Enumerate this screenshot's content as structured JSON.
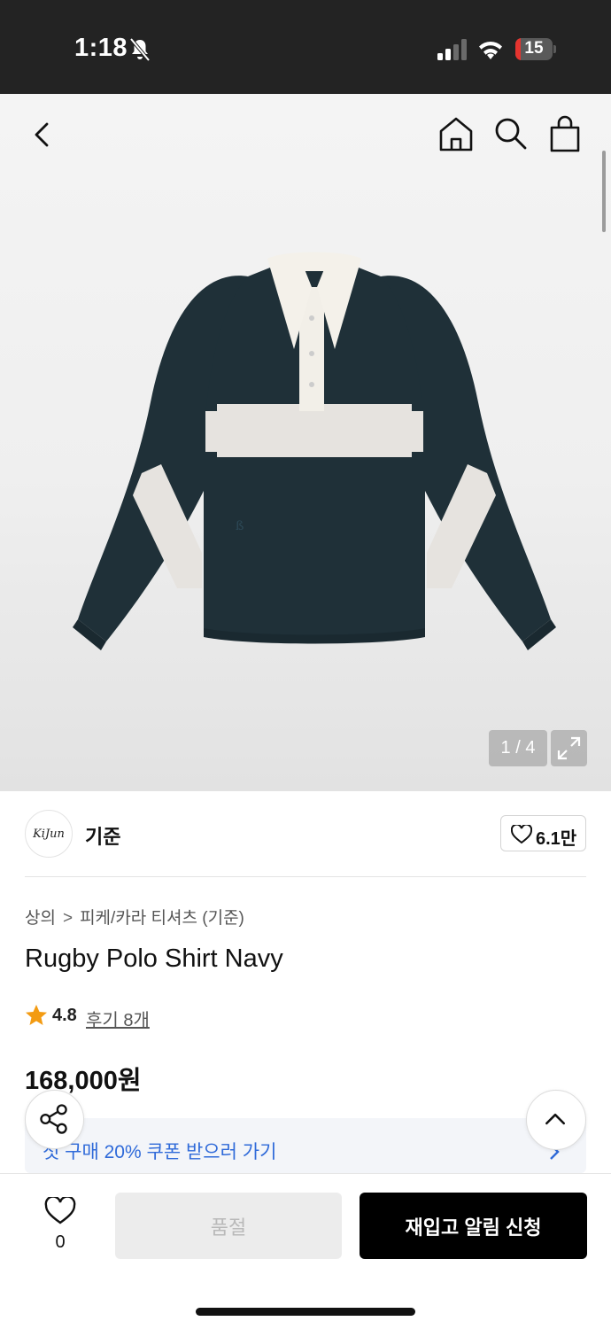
{
  "status_bar": {
    "time": "1:18",
    "battery": "15",
    "battery_level": 0.15,
    "battery_color": "#e5342f",
    "icons": [
      "bell-slash-icon",
      "cellular-signal-icon",
      "wifi-icon",
      "battery-icon"
    ]
  },
  "gallery": {
    "page_counter": "1 / 4",
    "current_page": 1,
    "total_pages": 4,
    "icons": [
      "back-icon",
      "home-icon",
      "search-icon",
      "shopping-bag-icon",
      "expand-icon"
    ]
  },
  "brand": {
    "logo_text": "KiJun",
    "name": "기준",
    "likes": "6.1만"
  },
  "product": {
    "breadcrumb": [
      "상의",
      "피케/카라 티셔츠 (기준)"
    ],
    "title": "Rugby Polo Shirt Navy",
    "rating": "4.8",
    "review_link": "후기 8개",
    "price": "168,000원",
    "rating_color": "#f39b12"
  },
  "coupon": {
    "text": "첫 구매 20% 쿠폰 받으러 가기",
    "color": "#2f6ad9"
  },
  "bottom_bar": {
    "wish_count": "0",
    "soldout_label": "품절",
    "restock_label": "재입고 알림 신청"
  },
  "floating": {
    "icons": [
      "share-icon",
      "chevron-up-icon"
    ]
  }
}
